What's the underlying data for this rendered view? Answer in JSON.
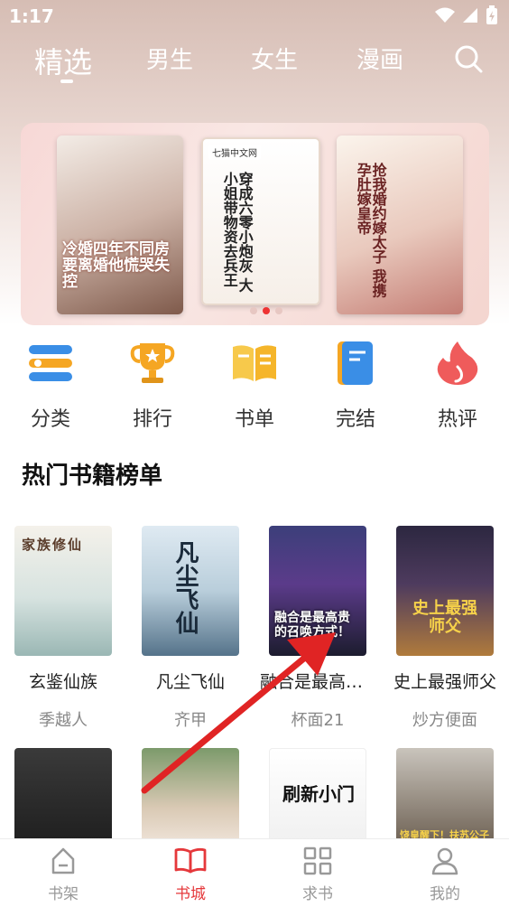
{
  "status": {
    "time": "1:17"
  },
  "nav": {
    "tabs": [
      {
        "label": "精选",
        "active": true
      },
      {
        "label": "男生",
        "active": false
      },
      {
        "label": "女生",
        "active": false
      },
      {
        "label": "漫画",
        "active": false
      }
    ]
  },
  "banner": {
    "covers": [
      {
        "title": "冷婚四年不同房 要离婚他慌哭失控",
        "brand": ""
      },
      {
        "title": "穿成六零小炮灰 大小姐带物资去兵王",
        "brand": "七猫中文网"
      },
      {
        "title": "抢我婚约嫁太子 我携孕肚嫁皇帝",
        "brand": ""
      }
    ],
    "dots": 3,
    "active_dot": 1
  },
  "categories": [
    {
      "label": "分类",
      "icon": "list-icon"
    },
    {
      "label": "排行",
      "icon": "trophy-icon"
    },
    {
      "label": "书单",
      "icon": "book-open-icon"
    },
    {
      "label": "完结",
      "icon": "notebook-icon"
    },
    {
      "label": "热评",
      "icon": "flame-icon"
    }
  ],
  "section": {
    "title": "热门书籍榜单"
  },
  "books": [
    {
      "title": "玄鉴仙族",
      "author": "季越人",
      "cover_text": "家族修仙"
    },
    {
      "title": "凡尘飞仙",
      "author": "齐甲",
      "cover_text": "凡尘飞仙"
    },
    {
      "title": "融合是最高贵…",
      "author": "杯面21",
      "cover_text": "融合是最高贵的召唤方式！"
    },
    {
      "title": "史上最强师父",
      "author": "炒方便面",
      "cover_text": "史上最强师父"
    }
  ],
  "books_row2": [
    {
      "cover_text": ""
    },
    {
      "cover_text": ""
    },
    {
      "cover_text": "刷新小门"
    },
    {
      "cover_text": "饶皇醒下！扶苏公子他"
    }
  ],
  "tabbar": [
    {
      "label": "书架",
      "icon": "bookshelf-icon",
      "active": false
    },
    {
      "label": "书城",
      "icon": "open-book-icon",
      "active": true
    },
    {
      "label": "求书",
      "icon": "grid-icon",
      "active": false
    },
    {
      "label": "我的",
      "icon": "user-icon",
      "active": false
    }
  ],
  "colors": {
    "accent": "#e5383b",
    "text": "#222222",
    "muted": "#888888"
  }
}
